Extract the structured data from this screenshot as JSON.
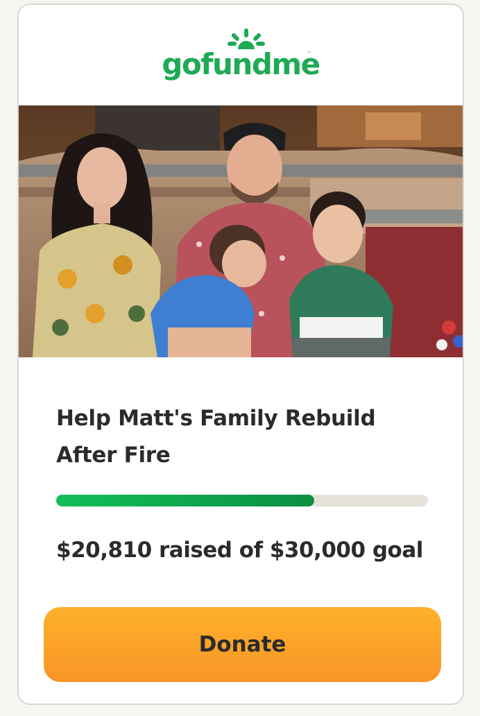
{
  "brand": {
    "logo_text": "gofundme",
    "tm": "™",
    "color": "#1faa55"
  },
  "campaign": {
    "title": "Help Matt's Family Rebuild After Fire",
    "progress_fraction": 0.6937,
    "raised_text": "$20,810 raised of $30,000 goal"
  },
  "donate_button": {
    "label": "Donate",
    "gradient_top": "#fdb22c",
    "gradient_bottom": "#f99426"
  },
  "progress_colors": {
    "fill_start": "#12bf58",
    "fill_end": "#0b8f42",
    "track": "#e6e2da"
  },
  "icons": {
    "logo_sun": "sun-rays-icon"
  }
}
